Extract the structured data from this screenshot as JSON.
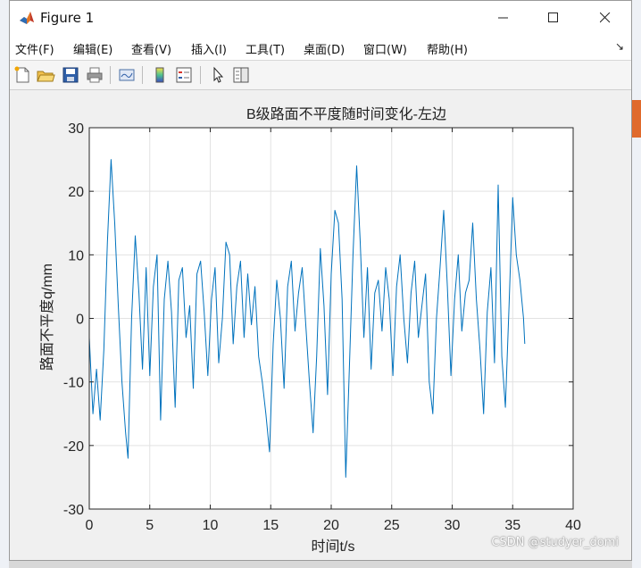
{
  "window": {
    "title": "Figure 1"
  },
  "menu": [
    "文件(F)",
    "编辑(E)",
    "查看(V)",
    "插入(I)",
    "工具(T)",
    "桌面(D)",
    "窗口(W)",
    "帮助(H)"
  ],
  "toolbar_icons": [
    "new-figure-icon",
    "open-file-icon",
    "save-icon",
    "print-icon",
    "link-plot-icon",
    "insert-colorbar-icon",
    "insert-legend-icon",
    "edit-plot-icon",
    "property-inspector-icon"
  ],
  "colors": {
    "line": "#0072bd",
    "grid": "#e2e2e2",
    "axes_bg": "#ffffff",
    "figure_bg": "#f0f0f0"
  },
  "watermark": "CSDN @studyer_domi",
  "chart_data": {
    "type": "line",
    "title": "B级路面不平度随时间变化-左边",
    "xlabel": "时间t/s",
    "ylabel": "路面不平度q/mm",
    "xlim": [
      0,
      40
    ],
    "ylim": [
      -30,
      30
    ],
    "xticks": [
      0,
      5,
      10,
      15,
      20,
      25,
      30,
      35,
      40
    ],
    "yticks": [
      -30,
      -20,
      -10,
      0,
      10,
      20,
      30
    ],
    "grid": true,
    "series": [
      {
        "x": [
          0,
          0.3,
          0.6,
          0.9,
          1.2,
          1.5,
          1.8,
          2.1,
          2.4,
          2.7,
          3.0,
          3.2,
          3.5,
          3.8,
          4.1,
          4.4,
          4.7,
          5.0,
          5.3,
          5.6,
          5.9,
          6.2,
          6.5,
          6.8,
          7.1,
          7.4,
          7.7,
          8.0,
          8.3,
          8.6,
          8.9,
          9.2,
          9.5,
          9.8,
          10.1,
          10.4,
          10.7,
          11.0,
          11.3,
          11.6,
          11.9,
          12.2,
          12.5,
          12.8,
          13.1,
          13.4,
          13.7,
          14.0,
          14.3,
          14.6,
          14.9,
          15.2,
          15.5,
          15.8,
          16.1,
          16.4,
          16.7,
          17.0,
          17.3,
          17.6,
          17.9,
          18.2,
          18.5,
          18.8,
          19.1,
          19.4,
          19.7,
          20.0,
          20.3,
          20.6,
          20.9,
          21.2,
          21.5,
          21.8,
          22.1,
          22.4,
          22.7,
          23.0,
          23.3,
          23.6,
          23.9,
          24.2,
          24.5,
          24.8,
          25.1,
          25.4,
          25.7,
          26.0,
          26.3,
          26.6,
          26.9,
          27.2,
          27.5,
          27.8,
          28.1,
          28.4,
          28.7,
          29.0,
          29.3,
          29.6,
          29.9,
          30.2,
          30.5,
          30.8,
          31.1,
          31.4,
          31.7,
          32.0,
          32.3,
          32.6,
          32.9,
          33.2,
          33.5,
          33.8,
          34.1,
          34.4,
          34.7,
          35.0,
          35.3,
          35.6,
          35.9,
          36.0
        ],
        "values": [
          -3,
          -15,
          -8,
          -16,
          -5,
          12,
          25,
          15,
          2,
          -10,
          -18,
          -22,
          0,
          13,
          4,
          -8,
          8,
          -9,
          5,
          10,
          -16,
          3,
          9,
          1,
          -14,
          6,
          8,
          -3,
          2,
          -11,
          7,
          9,
          1,
          -9,
          3,
          8,
          -7,
          0,
          12,
          10,
          -4,
          5,
          9,
          -3,
          7,
          -1,
          5,
          -6,
          -10,
          -15,
          -21,
          -4,
          6,
          0,
          -11,
          5,
          9,
          -2,
          4,
          8,
          -1,
          -10,
          -18,
          -6,
          11,
          2,
          -12,
          7,
          17,
          15,
          3,
          -25,
          -8,
          10,
          24,
          12,
          -3,
          8,
          -8,
          4,
          6,
          -2,
          8,
          3,
          -9,
          5,
          10,
          0,
          -7,
          4,
          9,
          -3,
          2,
          7,
          -10,
          -15,
          0,
          8,
          17,
          5,
          -9,
          3,
          10,
          -2,
          4,
          6,
          15,
          3,
          -5,
          -15,
          1,
          8,
          -7,
          21,
          -6,
          -14,
          2,
          19,
          10,
          6,
          0,
          -4
        ]
      }
    ]
  }
}
